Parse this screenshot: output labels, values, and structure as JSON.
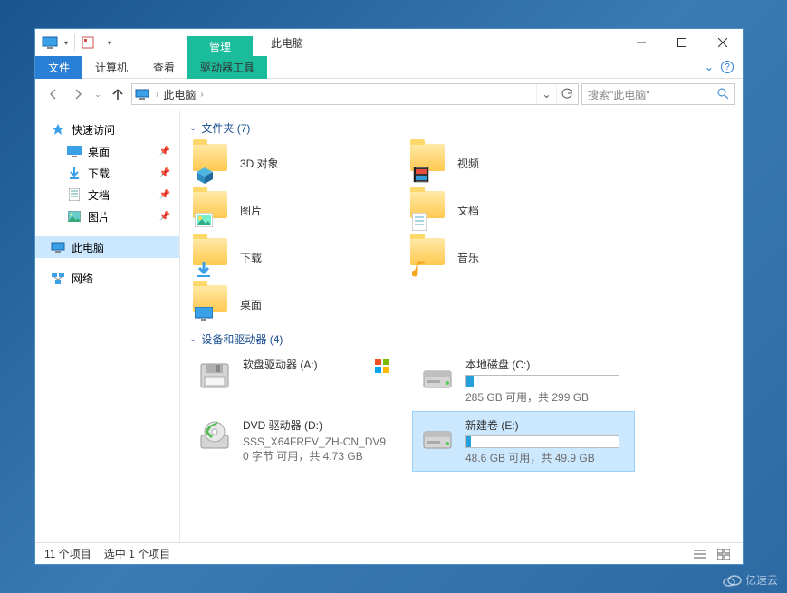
{
  "window": {
    "title_context": "管理",
    "title": "此电脑"
  },
  "ribbon": {
    "file": "文件",
    "tabs": [
      "计算机",
      "查看",
      "驱动器工具"
    ]
  },
  "address": {
    "location": "此电脑",
    "search_placeholder": "搜索\"此电脑\""
  },
  "nav": {
    "quick_access": "快速访问",
    "quick_items": [
      {
        "label": "桌面",
        "icon": "desktop"
      },
      {
        "label": "下载",
        "icon": "downloads"
      },
      {
        "label": "文档",
        "icon": "documents"
      },
      {
        "label": "图片",
        "icon": "pictures"
      }
    ],
    "this_pc": "此电脑",
    "network": "网络"
  },
  "sections": {
    "folders": {
      "title": "文件夹 (7)"
    },
    "devices": {
      "title": "设备和驱动器 (4)"
    }
  },
  "folders": [
    {
      "label": "3D 对象",
      "overlay": "3d"
    },
    {
      "label": "视频",
      "overlay": "video"
    },
    {
      "label": "图片",
      "overlay": "pictures"
    },
    {
      "label": "文档",
      "overlay": "documents"
    },
    {
      "label": "下载",
      "overlay": "downloads"
    },
    {
      "label": "音乐",
      "overlay": "music"
    },
    {
      "label": "桌面",
      "overlay": "desktop"
    }
  ],
  "drives": [
    {
      "name": "软盘驱动器 (A:)",
      "type": "floppy",
      "stats": "",
      "fill": 0
    },
    {
      "name": "本地磁盘 (C:)",
      "type": "hdd",
      "stats": "285 GB 可用，共 299 GB",
      "fill": 5
    },
    {
      "name": "DVD 驱动器 (D:)",
      "sub1": "SSS_X64FREV_ZH-CN_DV9",
      "sub2": "0 字节 可用，共 4.73 GB",
      "type": "dvd",
      "fill": 0
    },
    {
      "name": "新建卷 (E:)",
      "type": "hdd",
      "stats": "48.6 GB 可用，共 49.9 GB",
      "fill": 3,
      "selected": true
    }
  ],
  "status": {
    "count": "11 个项目",
    "selection": "选中 1 个项目"
  },
  "watermark": "亿速云"
}
